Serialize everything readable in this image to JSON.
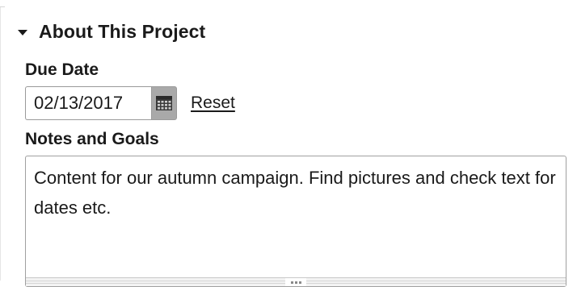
{
  "section": {
    "title": "About This Project",
    "expanded": true
  },
  "due_date": {
    "label": "Due Date",
    "value": "02/13/2017",
    "calendar_icon": "calendar-icon",
    "reset_label": "Reset"
  },
  "notes": {
    "label": "Notes and Goals",
    "value": "Content for our autumn campaign. Find pictures and check text for dates etc."
  },
  "colors": {
    "text": "#1a1a1a",
    "calendar_button": "#a9a9a9",
    "border": "#9a9a9a"
  }
}
